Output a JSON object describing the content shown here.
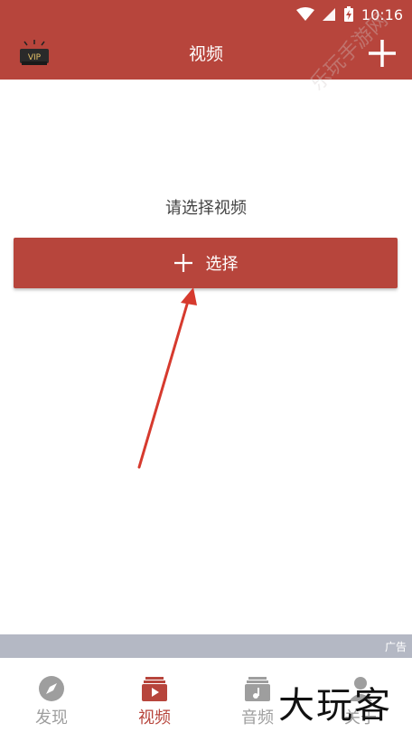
{
  "status": {
    "time": "10:16"
  },
  "appbar": {
    "title": "视频",
    "vip_text": "VIP"
  },
  "main": {
    "prompt": "请选择视频",
    "select_label": "选择"
  },
  "ad": {
    "label": "广告"
  },
  "tabs": [
    {
      "label": "发现",
      "icon": "compass-icon",
      "active": false
    },
    {
      "label": "视频",
      "icon": "video-icon",
      "active": true
    },
    {
      "label": "音频",
      "icon": "music-icon",
      "active": false
    },
    {
      "label": "关于",
      "icon": "person-icon",
      "active": false
    }
  ],
  "watermark": {
    "brand": "大玩客",
    "side_text": "乐玩手游网"
  },
  "colors": {
    "primary": "#b7453c",
    "inactive": "#9e9e9e",
    "ad_bar": "#b4b8c4"
  }
}
